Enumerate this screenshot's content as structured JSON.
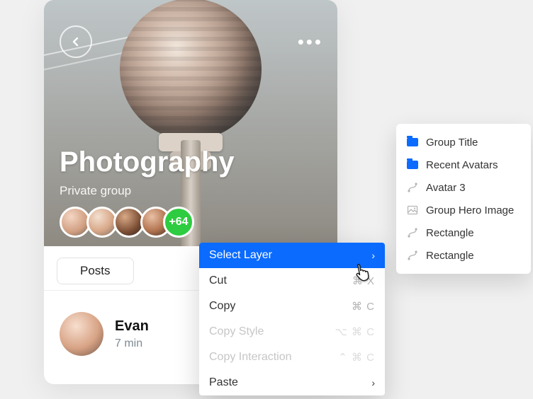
{
  "hero": {
    "title": "Photography",
    "subtitle": "Private group",
    "avatar_more": "+64"
  },
  "tabs": {
    "posts": "Posts"
  },
  "post": {
    "name": "Evan",
    "time": "7 min"
  },
  "context_menu": {
    "select_layer": "Select Layer",
    "cut": "Cut",
    "cut_kbd": "⌘ X",
    "copy": "Copy",
    "copy_kbd": "⌘ C",
    "copy_style": "Copy Style",
    "copy_style_kbd": "⌥ ⌘ C",
    "copy_interaction": "Copy Interaction",
    "copy_interaction_kbd": "⌃ ⌘ C",
    "paste": "Paste"
  },
  "layers": {
    "group_title": "Group Title",
    "recent_avatars": "Recent Avatars",
    "avatar3": "Avatar 3",
    "group_hero": "Group Hero Image",
    "rectangle1": "Rectangle",
    "rectangle2": "Rectangle"
  }
}
